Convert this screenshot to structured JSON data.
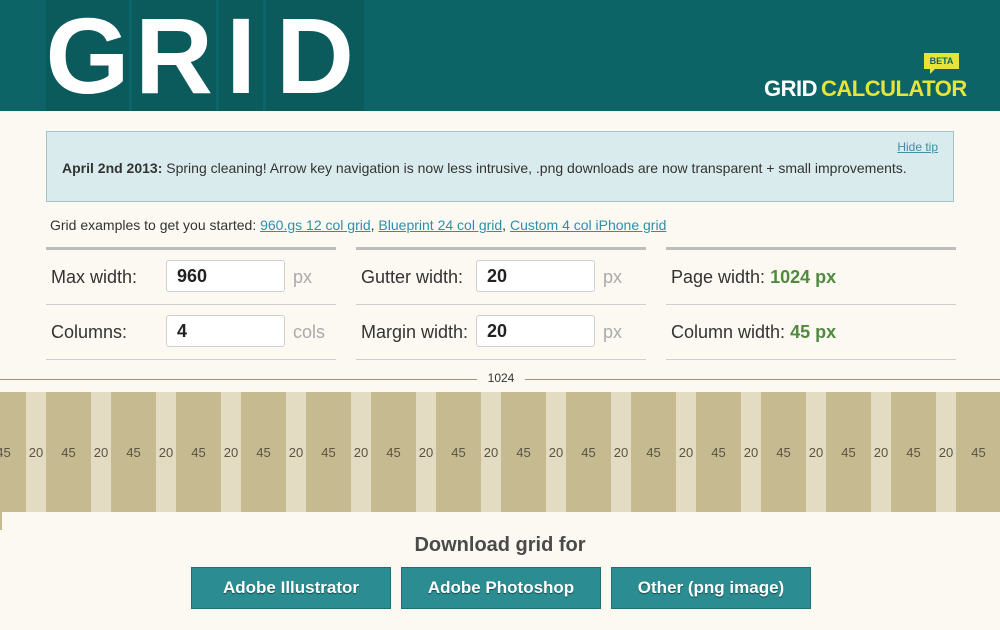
{
  "header": {
    "logo_letters": [
      "G",
      "R",
      "I",
      "D"
    ],
    "brand_grid": "GRID",
    "brand_calculator": "CALCULATOR",
    "beta": "BETA"
  },
  "tip": {
    "hide_label": "Hide tip",
    "date": "April 2nd 2013:",
    "message": " Spring cleaning! Arrow key navigation is now less intrusive, .png downloads are now transparent + small improvements."
  },
  "examples": {
    "intro": "Grid examples to get you started: ",
    "links": [
      "960.gs 12 col grid",
      "Blueprint 24 col grid",
      "Custom 4 col iPhone grid"
    ]
  },
  "form": {
    "max_width_label": "Max width:",
    "max_width_value": "960",
    "max_width_unit": "px",
    "columns_label": "Columns:",
    "columns_value": "4",
    "columns_unit": "cols",
    "gutter_label": "Gutter width:",
    "gutter_value": "20",
    "gutter_unit": "px",
    "margin_label": "Margin width:",
    "margin_value": "20",
    "margin_unit": "px",
    "page_width_label": "Page width: ",
    "page_width_value": "1024 px",
    "column_width_label": "Column width: ",
    "column_width_value": "45 px"
  },
  "preview": {
    "total_label": "1024",
    "column_label": "45",
    "gutter_label": "20",
    "visible_columns": 16
  },
  "download": {
    "title": "Download grid for",
    "buttons": [
      "Adobe Illustrator",
      "Adobe Photoshop",
      "Other (png image)"
    ]
  },
  "colors": {
    "header": "#0d6466",
    "accent_yellow": "#e6e43a",
    "column": "#c6bb90",
    "gutter": "#e3dbc2",
    "button": "#2b8c91",
    "value_green": "#4f8a3f"
  }
}
